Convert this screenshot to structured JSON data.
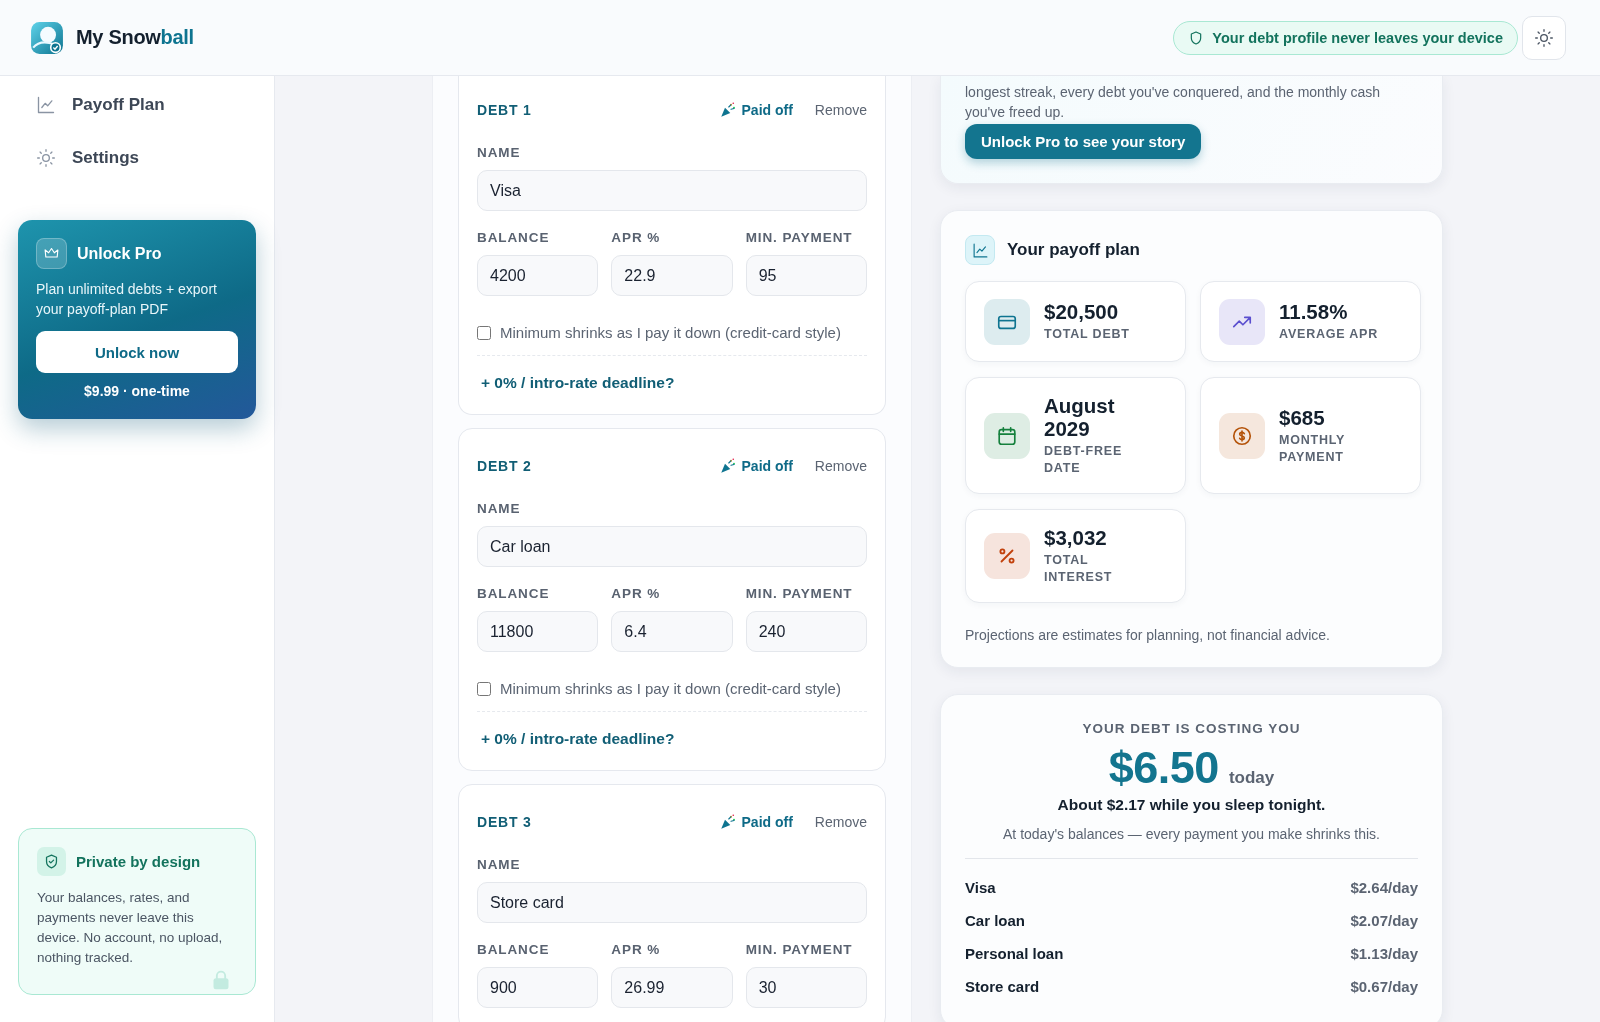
{
  "brand": {
    "text": "My Snow",
    "accent": "ball"
  },
  "header": {
    "privacy_pill": "Your debt profile never leaves your device"
  },
  "sidebar": {
    "nav": [
      {
        "label": "Payoff Plan",
        "selected": false
      },
      {
        "label": "Settings",
        "selected": false
      }
    ],
    "promo": {
      "title": "Unlock Pro",
      "description": "Plan unlimited debts + export your payoff-plan PDF",
      "button": "Unlock now",
      "price": "$9.99 · one-time"
    },
    "privacy": {
      "title": "Private by design",
      "text": "Your balances, rates, and payments never leave this device. No account, no upload, nothing tracked."
    }
  },
  "debts": [
    {
      "label": "DEBT 1",
      "paid_off": "Paid off",
      "remove": "Remove",
      "name": {
        "label": "NAME",
        "value": "Visa"
      },
      "numbers": [
        {
          "label": "BALANCE",
          "value": "4200"
        },
        {
          "label": "APR %",
          "value": "22.9"
        },
        {
          "label": "MIN. PAYMENT",
          "value": "95"
        }
      ],
      "shrink": {
        "label": "Minimum shrinks as I pay it down (credit-card style)",
        "checked": false
      },
      "intro_link": "+ 0% / intro-rate deadline?"
    },
    {
      "label": "DEBT 2",
      "paid_off": "Paid off",
      "remove": "Remove",
      "name": {
        "label": "NAME",
        "value": "Car loan"
      },
      "numbers": [
        {
          "label": "BALANCE",
          "value": "11800"
        },
        {
          "label": "APR %",
          "value": "6.4"
        },
        {
          "label": "MIN. PAYMENT",
          "value": "240"
        }
      ],
      "shrink": {
        "label": "Minimum shrinks as I pay it down (credit-card style)",
        "checked": false
      },
      "intro_link": "+ 0% / intro-rate deadline?"
    },
    {
      "label": "DEBT 3",
      "paid_off": "Paid off",
      "remove": "Remove",
      "name": {
        "label": "NAME",
        "value": "Store card"
      },
      "numbers": [
        {
          "label": "BALANCE",
          "value": "900"
        },
        {
          "label": "APR %",
          "value": "26.99"
        },
        {
          "label": "MIN. PAYMENT",
          "value": "30"
        }
      ]
    }
  ],
  "story": {
    "text": "longest streak, every debt you've conquered, and the monthly cash you've freed up.",
    "button": "Unlock Pro to see your story"
  },
  "plan": {
    "title": "Your payoff plan",
    "stats": [
      {
        "value": "$20,500",
        "label": "TOTAL DEBT",
        "color": "#0e7490"
      },
      {
        "value": "11.58%",
        "label": "AVERAGE APR",
        "color": "#5b4fcf"
      },
      {
        "value": "August 2029",
        "label": "DEBT-FREE DATE",
        "color": "#15803d"
      },
      {
        "value": "$685",
        "label": "MONTHLY PAYMENT",
        "color": "#b45309"
      },
      {
        "value": "$3,032",
        "label": "TOTAL INTEREST",
        "color": "#c2410c"
      }
    ],
    "disclaimer": "Projections are estimates for planning, not financial advice."
  },
  "cost": {
    "heading": "YOUR DEBT IS COSTING YOU",
    "amount": "$6.50",
    "suffix": "today",
    "sleep": "About $2.17 while you sleep tonight.",
    "note": "At today's balances — every payment you make shrinks this.",
    "breakdown": [
      {
        "name": "Visa",
        "rate": "$2.64/day"
      },
      {
        "name": "Car loan",
        "rate": "$2.07/day"
      },
      {
        "name": "Personal loan",
        "rate": "$1.13/day"
      },
      {
        "name": "Store card",
        "rate": "$0.67/day"
      }
    ]
  }
}
